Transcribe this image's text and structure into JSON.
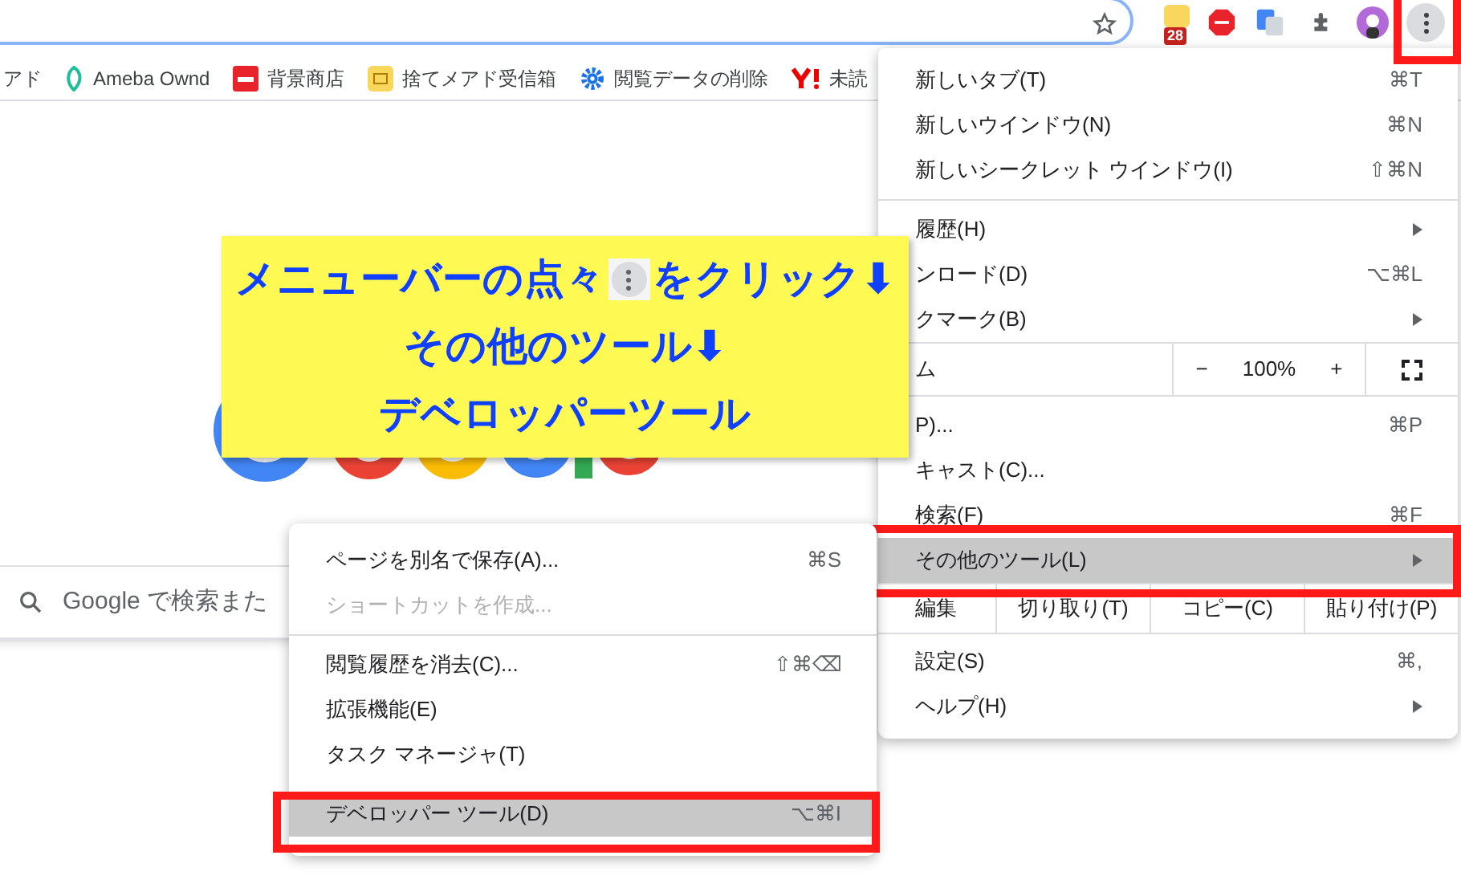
{
  "toolbar": {
    "extension_badge": "28",
    "menu_button_highlighted": true
  },
  "bookmarks": [
    {
      "label": "アド"
    },
    {
      "label": "Ameba Ownd"
    },
    {
      "label": "背景商店"
    },
    {
      "label": "捨てメアド受信箱"
    },
    {
      "label": "閲覧データの削除"
    },
    {
      "label": "未読"
    }
  ],
  "search_box": {
    "placeholder": "Google で検索また"
  },
  "main_menu": {
    "items": [
      {
        "kind": "item",
        "label": "新しいタブ(T)",
        "shortcut": "⌘T",
        "submenu": false,
        "selected": false,
        "highlighted": false
      },
      {
        "kind": "item",
        "label": "新しいウインドウ(N)",
        "shortcut": "⌘N",
        "submenu": false,
        "selected": false,
        "highlighted": false
      },
      {
        "kind": "item",
        "label": "新しいシークレット ウインドウ(I)",
        "shortcut": "⇧⌘N",
        "submenu": false,
        "selected": false,
        "highlighted": false
      },
      {
        "kind": "divider"
      },
      {
        "kind": "item",
        "label": "履歴(H)",
        "submenu": true,
        "selected": false,
        "highlighted": false
      },
      {
        "kind": "item",
        "label": "ンロード(D)",
        "shortcut": "⌥⌘L",
        "submenu": false,
        "selected": false,
        "highlighted": false
      },
      {
        "kind": "item",
        "label": "クマーク(B)",
        "submenu": true,
        "selected": false,
        "highlighted": false
      },
      {
        "kind": "zoom",
        "label": "ム",
        "minus": "−",
        "value": "100%",
        "plus": "+"
      },
      {
        "kind": "item",
        "label": "P)...",
        "shortcut": "⌘P",
        "submenu": false,
        "selected": false,
        "highlighted": false
      },
      {
        "kind": "item",
        "label": "キャスト(C)...",
        "submenu": false,
        "selected": false,
        "highlighted": false
      },
      {
        "kind": "item",
        "label": "検索(F)",
        "shortcut": "⌘F",
        "submenu": false,
        "selected": false,
        "highlighted": false
      },
      {
        "kind": "item",
        "label": "その他のツール(L)",
        "submenu": true,
        "selected": true,
        "highlighted": true
      },
      {
        "kind": "edit",
        "label": "編集",
        "actions": [
          "切り取り(T)",
          "コピー(C)",
          "貼り付け(P)"
        ]
      },
      {
        "kind": "item",
        "label": "設定(S)",
        "shortcut": "⌘,",
        "submenu": false,
        "selected": false,
        "highlighted": false
      },
      {
        "kind": "item",
        "label": "ヘルプ(H)",
        "submenu": true,
        "selected": false,
        "highlighted": false
      }
    ]
  },
  "submenu": {
    "items": [
      {
        "kind": "item",
        "label": "ページを別名で保存(A)...",
        "shortcut": "⌘S",
        "disabled": false,
        "selected": false,
        "highlighted": false
      },
      {
        "kind": "item",
        "label": "ショートカットを作成...",
        "disabled": true,
        "selected": false,
        "highlighted": false
      },
      {
        "kind": "divider"
      },
      {
        "kind": "item",
        "label": "閲覧履歴を消去(C)...",
        "shortcut": "⇧⌘⌫",
        "disabled": false,
        "selected": false,
        "highlighted": false
      },
      {
        "kind": "item",
        "label": "拡張機能(E)",
        "disabled": false,
        "selected": false,
        "highlighted": false
      },
      {
        "kind": "item",
        "label": "タスク マネージャ(T)",
        "disabled": false,
        "selected": false,
        "highlighted": false
      },
      {
        "kind": "item",
        "label": "デベロッパー ツール(D)",
        "shortcut": "⌥⌘I",
        "disabled": false,
        "selected": true,
        "highlighted": true
      }
    ]
  },
  "annotation": {
    "lines": [
      {
        "text": "メニューバーの点々",
        "after_icon": "をクリック⬇"
      },
      {
        "text": "その他のツール⬇"
      },
      {
        "text": "デベロッパーツール"
      }
    ]
  }
}
